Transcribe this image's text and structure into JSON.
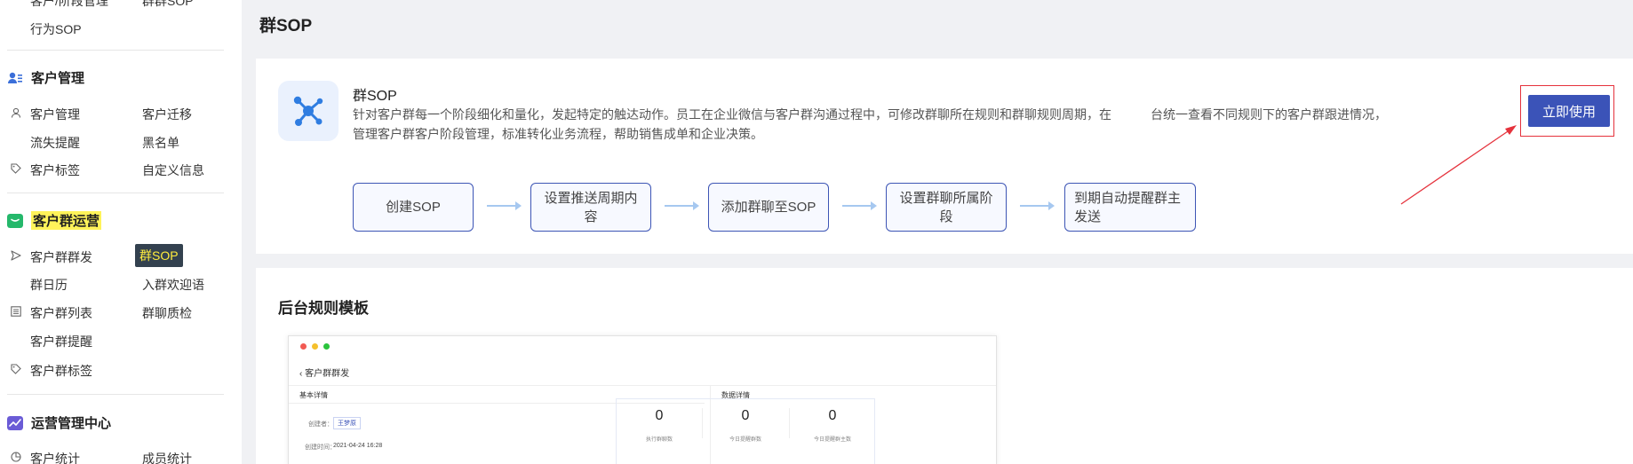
{
  "sidebar": {
    "top_partial": [
      "客户/阶段管理",
      "群群SOP"
    ],
    "top_item": "行为SOP",
    "sections": [
      {
        "title": "客户管理",
        "icon": "user-group-icon",
        "rows": [
          [
            "客户管理",
            "客户迁移"
          ],
          [
            "流失提醒",
            "黑名单"
          ],
          [
            "客户标签",
            "自定义信息"
          ]
        ]
      },
      {
        "title": "客户群运营",
        "icon": "chat-bubble-icon",
        "rows": [
          [
            "客户群群发",
            "群SOP"
          ],
          [
            "群日历",
            "入群欢迎语"
          ],
          [
            "客户群列表",
            "群聊质检"
          ],
          [
            "客户群提醒",
            ""
          ],
          [
            "客户群标签",
            ""
          ]
        ]
      },
      {
        "title": "运营管理中心",
        "icon": "chart-icon",
        "rows": [
          [
            "客户统计",
            "成员统计"
          ]
        ]
      }
    ],
    "active_item": "群SOP"
  },
  "page": {
    "title": "群SOP"
  },
  "intro": {
    "title": "群SOP",
    "desc_part1": "针对客户群每一个阶段细化和量化，发起特定的触达动作。员工在企业微信与客户群沟通过程中，可修改群聊所在规则和群聊规则周期，在",
    "desc_part2": "台统一查看不同规则下的客户群跟进情况，",
    "desc_line2": "管理客户群客户阶段管理，标准转化业务流程，帮助销售成单和企业决策。",
    "cta_label": "立即使用"
  },
  "steps": [
    "创建SOP",
    "设置推送周期内容",
    "添加群聊至SOP",
    "设置群聊所属阶段",
    "到期自动提醒群主发送"
  ],
  "templates": {
    "title": "后台规则模板",
    "preview": {
      "back_label": "客户群群发",
      "left_title": "基本详情",
      "right_title": "数据详情",
      "creator_label": "创建者：",
      "creator_value": "王梦原",
      "time_label": "创建时间：",
      "time_value": "2021-04-24 16:28",
      "stats": [
        {
          "value": "0",
          "label": "执行群聊数"
        },
        {
          "value": "0",
          "label": "今日提醒群数"
        },
        {
          "value": "0",
          "label": "今日提醒群主数"
        }
      ]
    }
  },
  "colors": {
    "brand": "#3b53b8",
    "highlight": "#fff35a",
    "annotation_red": "#e5323c",
    "flow_arrow": "#a6c8f0"
  }
}
